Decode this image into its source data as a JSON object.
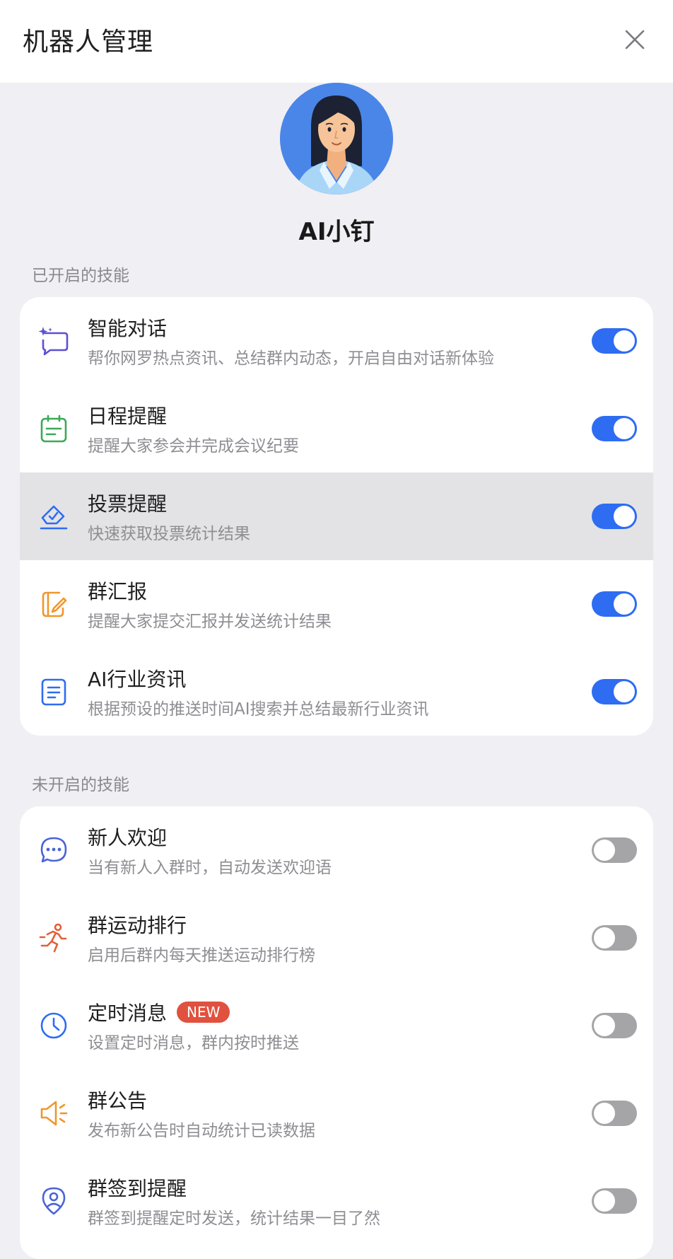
{
  "header": {
    "title": "机器人管理"
  },
  "bot": {
    "name": "AI小钉"
  },
  "enabled_section": {
    "label": "已开启的技能",
    "items": [
      {
        "title": "智能对话",
        "desc": "帮你网罗热点资讯、总结群内动态，开启自由对话新体验",
        "icon": "sparkle-chat-icon",
        "enabled": true
      },
      {
        "title": "日程提醒",
        "desc": "提醒大家参会并完成会议纪要",
        "icon": "calendar-icon",
        "enabled": true
      },
      {
        "title": "投票提醒",
        "desc": "快速获取投票统计结果",
        "icon": "vote-icon",
        "enabled": true
      },
      {
        "title": "群汇报",
        "desc": "提醒大家提交汇报并发送统计结果",
        "icon": "report-edit-icon",
        "enabled": true
      },
      {
        "title": "AI行业资讯",
        "desc": "根据预设的推送时间AI搜索并总结最新行业资讯",
        "icon": "document-icon",
        "enabled": true
      }
    ]
  },
  "disabled_section": {
    "label": "未开启的技能",
    "items": [
      {
        "title": "新人欢迎",
        "desc": "当有新人入群时，自动发送欢迎语",
        "icon": "chat-bubble-icon",
        "enabled": false
      },
      {
        "title": "群运动排行",
        "desc": "启用后群内每天推送运动排行榜",
        "icon": "running-icon",
        "enabled": false
      },
      {
        "title": "定时消息",
        "badge": "NEW",
        "desc": "设置定时消息，群内按时推送",
        "icon": "clock-icon",
        "enabled": false
      },
      {
        "title": "群公告",
        "desc": "发布新公告时自动统计已读数据",
        "icon": "megaphone-icon",
        "enabled": false
      },
      {
        "title": "群签到提醒",
        "desc": "群签到提醒定时发送，统计结果一目了然",
        "icon": "location-pin-icon",
        "enabled": false
      }
    ]
  },
  "colors": {
    "toggle_on": "#2e6cf2",
    "toggle_off": "#a5a5a8",
    "badge_new": "#e0523f"
  }
}
